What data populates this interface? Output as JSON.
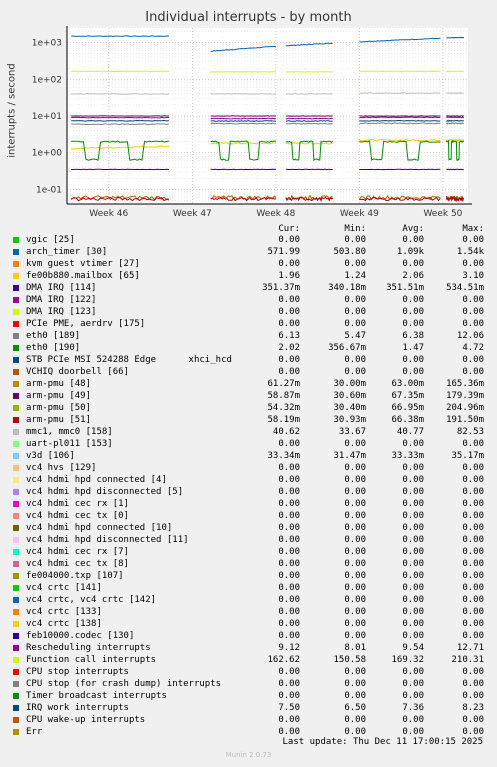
{
  "chart_data": {
    "type": "line",
    "title": "Individual interrupts - by month",
    "ylabel": "interrupts / second",
    "yscale": "log",
    "ylim": [
      0.04,
      2500
    ],
    "ytick_labels": [
      "1e-01",
      "1e+00",
      "1e+01",
      "1e+02",
      "1e+03"
    ],
    "ytick_values": [
      0.1,
      1,
      10,
      100,
      1000
    ],
    "xtick_labels": [
      "Week 46",
      "Week 47",
      "Week 48",
      "Week 49",
      "Week 50"
    ],
    "xlim": [
      45.5,
      50.3
    ],
    "grid": true,
    "legend_placement": "below",
    "data_gaps": [
      [
        46.72,
        47.22
      ],
      [
        48.0,
        48.12
      ],
      [
        48.68,
        49.0
      ],
      [
        49.97,
        50.04
      ]
    ],
    "series": [
      {
        "name": "vgic [25]",
        "color": "#00cc00",
        "cur": "0.00",
        "min": "0.00",
        "avg": "0.00",
        "max": "0.00",
        "plot": null
      },
      {
        "name": "arch_timer [30]",
        "color": "#0066b3",
        "cur": "571.99",
        "min": "503.80",
        "avg": "1.09k",
        "max": "1.54k",
        "plot": {
          "start": 1500,
          "end": 1500,
          "mid": 580,
          "end2": 1400,
          "noise": 0.02
        }
      },
      {
        "name": "kvm guest vtimer [27]",
        "color": "#ff8000",
        "cur": "0.00",
        "min": "0.00",
        "avg": "0.00",
        "max": "0.00",
        "plot": null
      },
      {
        "name": "fe00b880.mailbox [65]",
        "color": "#ffcc00",
        "cur": "1.96",
        "min": "1.24",
        "avg": "2.06",
        "max": "3.10",
        "plot": {
          "start": 1.3,
          "end": 1.5,
          "mid": 1.8,
          "end2": 2.2,
          "noise": 0.05
        }
      },
      {
        "name": "DMA IRQ [114]",
        "color": "#330099",
        "cur": "351.37m",
        "min": "340.18m",
        "avg": "351.51m",
        "max": "534.51m",
        "plot": {
          "start": 0.35,
          "end": 0.35,
          "mid": 0.35,
          "end2": 0.35,
          "noise": 0.01
        }
      },
      {
        "name": "DMA IRQ [122]",
        "color": "#990099",
        "cur": "0.00",
        "min": "0.00",
        "avg": "0.00",
        "max": "0.00",
        "plot": null
      },
      {
        "name": "DMA IRQ [123]",
        "color": "#ccff00",
        "cur": "0.00",
        "min": "0.00",
        "avg": "0.00",
        "max": "0.00",
        "plot": null
      },
      {
        "name": "PCIe PME, aerdrv [175]",
        "color": "#ff0000",
        "cur": "0.00",
        "min": "0.00",
        "avg": "0.00",
        "max": "0.00",
        "plot": null
      },
      {
        "name": "eth0 [189]",
        "color": "#808080",
        "cur": "6.13",
        "min": "5.47",
        "avg": "6.38",
        "max": "12.06",
        "plot": {
          "start": 6,
          "end": 6,
          "mid": 6.2,
          "end2": 6.3,
          "noise": 0.03
        }
      },
      {
        "name": "eth0 [190]",
        "color": "#008f00",
        "cur": "2.02",
        "min": "356.67m",
        "avg": "1.47",
        "max": "4.72",
        "plot": {
          "start": 1.9,
          "end": 0.65,
          "mid": 2.0,
          "end2": 0.7,
          "noise": 0.04
        }
      },
      {
        "name": "STB PCIe MSI 524288 Edge      xhci_hcd",
        "color": "#00487d",
        "cur": "0.00",
        "min": "0.00",
        "avg": "0.00",
        "max": "0.00",
        "plot": null
      },
      {
        "name": "VCHIQ doorbell [66]",
        "color": "#b35a00",
        "cur": "0.00",
        "min": "0.00",
        "avg": "0.00",
        "max": "0.00",
        "plot": {
          "start": 0.06,
          "end": 0.06,
          "mid": 0.06,
          "end2": 0.06,
          "noise": 0.12
        }
      },
      {
        "name": "arm-pmu [48]",
        "color": "#b38f00",
        "cur": "61.27m",
        "min": "30.00m",
        "avg": "63.00m",
        "max": "165.36m",
        "plot": null
      },
      {
        "name": "arm-pmu [49]",
        "color": "#6b006b",
        "cur": "58.87m",
        "min": "30.60m",
        "avg": "67.35m",
        "max": "179.39m",
        "plot": {
          "start": 10,
          "end": 10,
          "mid": 10,
          "end2": 10,
          "noise": 0.01
        }
      },
      {
        "name": "arm-pmu [50]",
        "color": "#8fb300",
        "cur": "54.32m",
        "min": "30.40m",
        "avg": "66.95m",
        "max": "204.96m",
        "plot": null
      },
      {
        "name": "arm-pmu [51]",
        "color": "#b30000",
        "cur": "58.19m",
        "min": "30.93m",
        "avg": "66.38m",
        "max": "191.50m",
        "plot": {
          "start": 0.055,
          "end": 0.055,
          "mid": 0.055,
          "end2": 0.055,
          "noise": 0.1
        }
      },
      {
        "name": "mmc1, mmc0 [158]",
        "color": "#bebebe",
        "cur": "40.62",
        "min": "33.67",
        "avg": "40.77",
        "max": "82.53",
        "plot": {
          "start": 40,
          "end": 40,
          "mid": 40,
          "end2": 42,
          "noise": 0.02
        }
      },
      {
        "name": "uart-pl011 [153]",
        "color": "#80ff80",
        "cur": "0.00",
        "min": "0.00",
        "avg": "0.00",
        "max": "0.00",
        "plot": null
      },
      {
        "name": "v3d [106]",
        "color": "#80c9ff",
        "cur": "33.34m",
        "min": "31.47m",
        "avg": "33.33m",
        "max": "35.17m",
        "plot": null
      },
      {
        "name": "vc4 hvs [129]",
        "color": "#ffc080",
        "cur": "0.00",
        "min": "0.00",
        "avg": "0.00",
        "max": "0.00",
        "plot": null
      },
      {
        "name": "vc4 hdmi hpd connected [4]",
        "color": "#ffe680",
        "cur": "0.00",
        "min": "0.00",
        "avg": "0.00",
        "max": "0.00",
        "plot": null
      },
      {
        "name": "vc4 hdmi hpd disconnected [5]",
        "color": "#aa80ff",
        "cur": "0.00",
        "min": "0.00",
        "avg": "0.00",
        "max": "0.00",
        "plot": null
      },
      {
        "name": "vc4 hdmi cec rx [1]",
        "color": "#ee00cc",
        "cur": "0.00",
        "min": "0.00",
        "avg": "0.00",
        "max": "0.00",
        "plot": null
      },
      {
        "name": "vc4 hdmi cec tx [0]",
        "color": "#ff8080",
        "cur": "0.00",
        "min": "0.00",
        "avg": "0.00",
        "max": "0.00",
        "plot": null
      },
      {
        "name": "vc4 hdmi hpd connected [10]",
        "color": "#666600",
        "cur": "0.00",
        "min": "0.00",
        "avg": "0.00",
        "max": "0.00",
        "plot": null
      },
      {
        "name": "vc4 hdmi hpd disconnected [11]",
        "color": "#ffbfff",
        "cur": "0.00",
        "min": "0.00",
        "avg": "0.00",
        "max": "0.00",
        "plot": null
      },
      {
        "name": "vc4 hdmi cec rx [7]",
        "color": "#00ffcc",
        "cur": "0.00",
        "min": "0.00",
        "avg": "0.00",
        "max": "0.00",
        "plot": null
      },
      {
        "name": "vc4 hdmi cec tx [8]",
        "color": "#cc6699",
        "cur": "0.00",
        "min": "0.00",
        "avg": "0.00",
        "max": "0.00",
        "plot": null
      },
      {
        "name": "fe004000.txp [107]",
        "color": "#999900",
        "cur": "0.00",
        "min": "0.00",
        "avg": "0.00",
        "max": "0.00",
        "plot": null
      },
      {
        "name": "vc4 crtc [141]",
        "color": "#00cc00",
        "cur": "0.00",
        "min": "0.00",
        "avg": "0.00",
        "max": "0.00",
        "plot": null
      },
      {
        "name": "vc4 crtc, vc4 crtc [142]",
        "color": "#0066b3",
        "cur": "0.00",
        "min": "0.00",
        "avg": "0.00",
        "max": "0.00",
        "plot": null
      },
      {
        "name": "vc4 crtc [133]",
        "color": "#ff8000",
        "cur": "0.00",
        "min": "0.00",
        "avg": "0.00",
        "max": "0.00",
        "plot": null
      },
      {
        "name": "vc4 crtc [138]",
        "color": "#ffcc00",
        "cur": "0.00",
        "min": "0.00",
        "avg": "0.00",
        "max": "0.00",
        "plot": null
      },
      {
        "name": "feb10000.codec [130]",
        "color": "#330099",
        "cur": "0.00",
        "min": "0.00",
        "avg": "0.00",
        "max": "0.00",
        "plot": null
      },
      {
        "name": "Rescheduling interrupts",
        "color": "#990099",
        "cur": "9.12",
        "min": "8.01",
        "avg": "9.54",
        "max": "12.71",
        "plot": {
          "start": 9,
          "end": 9,
          "mid": 8.5,
          "end2": 9.2,
          "noise": 0.02
        }
      },
      {
        "name": "Function call interrupts",
        "color": "#ccff00",
        "cur": "162.62",
        "min": "150.58",
        "avg": "169.32",
        "max": "210.31",
        "plot": {
          "start": 165,
          "end": 165,
          "mid": 160,
          "end2": 165,
          "noise": 0.01
        }
      },
      {
        "name": "CPU stop interrupts",
        "color": "#ff0000",
        "cur": "0.00",
        "min": "0.00",
        "avg": "0.00",
        "max": "0.00",
        "plot": null
      },
      {
        "name": "CPU stop (for crash dump) interrupts",
        "color": "#808080",
        "cur": "0.00",
        "min": "0.00",
        "avg": "0.00",
        "max": "0.00",
        "plot": null
      },
      {
        "name": "Timer broadcast interrupts",
        "color": "#008f00",
        "cur": "0.00",
        "min": "0.00",
        "avg": "0.00",
        "max": "0.00",
        "plot": null
      },
      {
        "name": "IRQ work interrupts",
        "color": "#00487d",
        "cur": "7.50",
        "min": "6.50",
        "avg": "7.36",
        "max": "8.23",
        "plot": {
          "start": 7.4,
          "end": 7.4,
          "mid": 7.3,
          "end2": 7.4,
          "noise": 0.02
        }
      },
      {
        "name": "CPU wake-up interrupts",
        "color": "#b35a00",
        "cur": "0.00",
        "min": "0.00",
        "avg": "0.00",
        "max": "0.00",
        "plot": null
      },
      {
        "name": "Err",
        "color": "#b38f00",
        "cur": "0.00",
        "min": "0.00",
        "avg": "0.00",
        "max": "0.00",
        "plot": null
      }
    ]
  },
  "legend_headers": {
    "cur": "Cur:",
    "min": "Min:",
    "avg": "Avg:",
    "max": "Max:"
  },
  "watermark": "RRDTOOL / TOBI OETIKER",
  "last_update": "Last update:  Thu Dec 11 17:00:15 2025",
  "footer": "Munin 2.0.73"
}
